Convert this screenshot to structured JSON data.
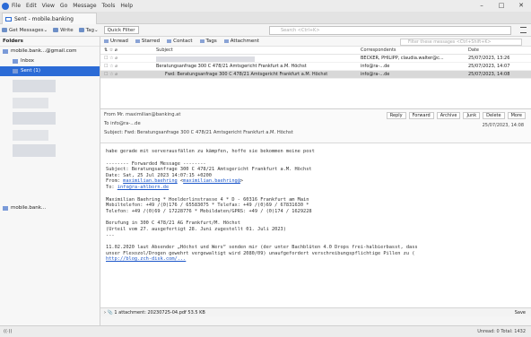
{
  "menubar": {
    "items": [
      "File",
      "Edit",
      "View",
      "Go",
      "Message",
      "Tools",
      "Help"
    ],
    "window_controls": [
      "–",
      "□",
      "✕"
    ]
  },
  "tab": {
    "label": "Sent - mobile.banking"
  },
  "toolbar": {
    "get_messages": "Get Messages",
    "write": "Write",
    "tag": "Tag",
    "quick_filter": "Quick Filter",
    "search_placeholder": "Search <Ctrl+K>"
  },
  "folders": {
    "header": "Folders",
    "account": "mobile.bank...@gmail.com",
    "inbox": "Inbox",
    "sent": "Sent (1)",
    "account2": "mobile.bank..."
  },
  "quickfilter": {
    "unread": "Unread",
    "starred": "Starred",
    "contact": "Contact",
    "tags": "Tags",
    "attachment": "Attachment",
    "search_placeholder": "Filter these messages <Ctrl+Shift+K>"
  },
  "columns": {
    "subject": "Subject",
    "correspondents": "Correspondents",
    "date": "Date"
  },
  "threads": [
    {
      "subject": "",
      "correspondents": "BECKER, PHILIPP, claudia.walter@c...",
      "date": "25/07/2023, 13:26"
    },
    {
      "subject": "Beratungsanfrage 300 C 478/21 Amtsgericht Frankfurt a.M. Höchst",
      "correspondents": "info@ra-...de",
      "date": "25/07/2023, 14:07"
    },
    {
      "subject": "Fwd: Beratungsanfrage 300 C 478/21 Amtsgericht Frankfurt a.M. Höchst",
      "correspondents": "info@ra-...de",
      "date": "25/07/2023, 14:08"
    }
  ],
  "message": {
    "from_label": "From",
    "from_value": "Mr. maximilian@banking.at",
    "to_label": "To",
    "to_value": "info@ra-...de",
    "subject_label": "Subject",
    "subject_value": "Fwd: Beratungsanfrage 300 C 478/21 Amtsgericht Frankfurt a.M. Höchst",
    "date": "25/07/2023, 14:08",
    "actions": [
      "Reply",
      "Forward",
      "Archive",
      "Junk",
      "Delete",
      "More"
    ]
  },
  "body": {
    "l1": "habe gerade mit serverausfällen zu kämpfen, hoffe sie bekommen meine post",
    "l2": "-------- Forwarded Message --------",
    "l3": "Subject: Beratungsanfrage 300 C 478/21 Amtsgericht Frankfurt a.M. Höchst",
    "l4": "Date: Sat, 25 Jul 2023 14:07:15 +0200",
    "l5_prefix": "From: ",
    "l5_link1": "maximilian.baehring",
    "l5_link2": "maximilian.baehring@",
    "l6_prefix": "To: ",
    "l6_link": "info@ra-ahlborn.de",
    "l7": "Maximilian Baehring * Hoelderlinstrasse 4 * D - 60316 Frankfurt am Main",
    "l8": "Mobiltelefon: +49 /(0)176 / 65583075 * Telefax: +49 /(0)69 / 67831630 *",
    "l9": "Telefon: +49 /(0)69 / 17228776 * Mobildaten/GPRS: +49 / (0)174 / 1629228",
    "l10": "Berufung in 300 C 478/21 AG Frankfurt/M. Höchst",
    "l11": "(Urteil vom 27. ausgefertigt 28. Juni zugestellt 01. Juli 2023)",
    "l12": "---",
    "l13": "11.02.2020 laut Absender „Höchst und Wers“ senden mir (der unter Bachblüten 4.0 Drops frei-halbierbasst, dass",
    "l14": "unser Flexozol/Drogen gewehrt vergewaltigt wird 2080/09) unaufgefordert verschreibungspflichtige Pillen zu (",
    "l15": "http://blog.zch-disk.com/..."
  },
  "attachment": {
    "label": "1 attachment: 20230725-04.pdf  53.5 KB",
    "save": "Save"
  },
  "status": {
    "left": "Unread: 0  Total: 1432"
  }
}
